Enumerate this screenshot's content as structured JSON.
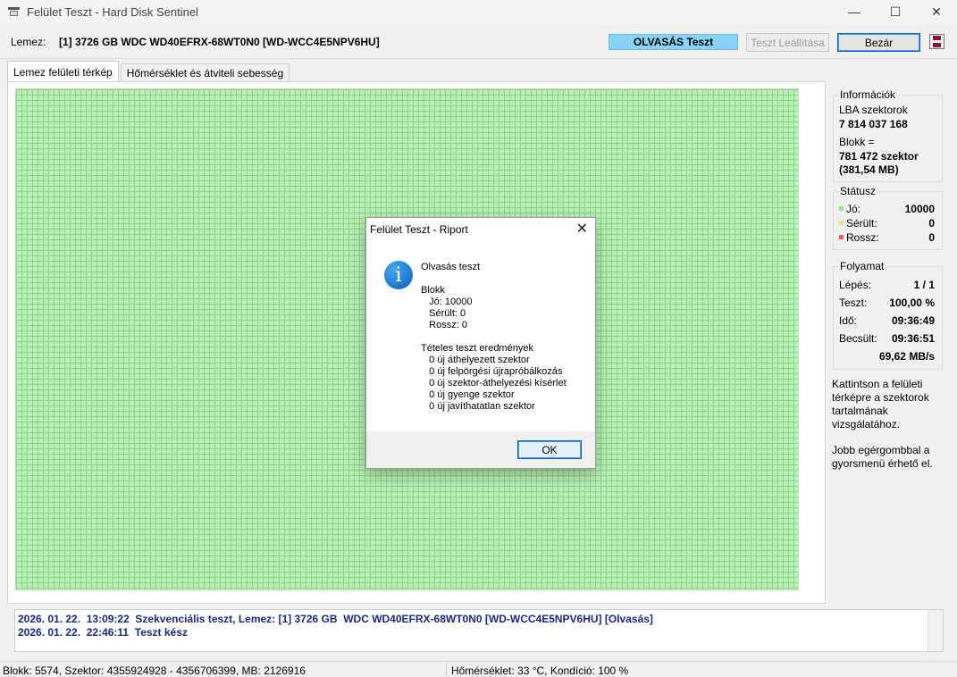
{
  "window": {
    "title": "Felület Teszt - Hard Disk Sentinel",
    "minimize": "—",
    "maximize": "☐",
    "close": "✕"
  },
  "toolbar": {
    "disk_label": "Lemez:",
    "disk_value": "[1] 3726 GB  WDC WD40EFRX-68WT0N0 [WD-WCC4E5NPV6HU]",
    "status": "OLVASÁS Teszt",
    "stop_label": "Teszt Leállítása",
    "close_label": "Bezár"
  },
  "tabs": [
    {
      "label": "Lemez felületi térkép",
      "active": true
    },
    {
      "label": "Hőmérséklet és átviteli sebesség",
      "active": false
    }
  ],
  "info": {
    "title": "Információk",
    "lba_label": "LBA szektorok",
    "lba_value": "7 814 037 168",
    "block_label": "Blokk =",
    "block_value": "781 472 szektor",
    "block_size": "(381,54 MB)"
  },
  "status": {
    "title": "Státusz",
    "good_label": "Jó:",
    "good_value": "10000",
    "damaged_label": "Sérült:",
    "damaged_value": "0",
    "bad_label": "Rossz:",
    "bad_value": "0",
    "colors": {
      "good": "#9be39a",
      "damaged": "#e8e090",
      "bad": "#e06060"
    }
  },
  "progress": {
    "title": "Folyamat",
    "step_label": "Lépés:",
    "step_value": "1 / 1",
    "test_label": "Teszt:",
    "test_value": "100,00 %",
    "time_label": "Idő:",
    "time_value": "09:36:49",
    "estimated_label": "Becsült:",
    "estimated_value": "09:36:51",
    "speed": "69,62 MB/s"
  },
  "help": {
    "text1_l1": "Kattintson a felületi",
    "text1_l2": "térképre a szektorok",
    "text1_l3": "tartalmának",
    "text1_l4": "vizsgálatához.",
    "text2_l1": "Jobb egérgombbal a",
    "text2_l2": "gyorsmenü érhető el."
  },
  "log": [
    "2026. 01. 22.  13:09:22  Szekvenciális teszt, Lemez: [1] 3726 GB  WDC WD40EFRX-68WT0N0 [WD-WCC4E5NPV6HU] [Olvasás]",
    "2026. 01. 22.  22:46:11  Teszt kész"
  ],
  "statusbar": {
    "left": "Blokk: 5574, Szektor: 4355924928 - 4356706399, MB: 2126916",
    "right": "Hőmérséklet: 33  °C,  Kondíció: 100 %"
  },
  "dialog": {
    "title": "Felület Teszt - Riport",
    "close": "✕",
    "icon": "i",
    "heading": "Olvasás teszt",
    "body": "Blokk\n   Jó: 10000\n   Sérült: 0\n   Rossz: 0\n\nTételes teszt eredmények\n   0 új áthelyezett szektor\n   0 új felpörgési újrapróbálkozás\n   0 új szektor-áthelyezési kísérlet\n   0 új gyenge szektor\n   0 új javíthatatlan szektor",
    "ok_label": "OK"
  }
}
